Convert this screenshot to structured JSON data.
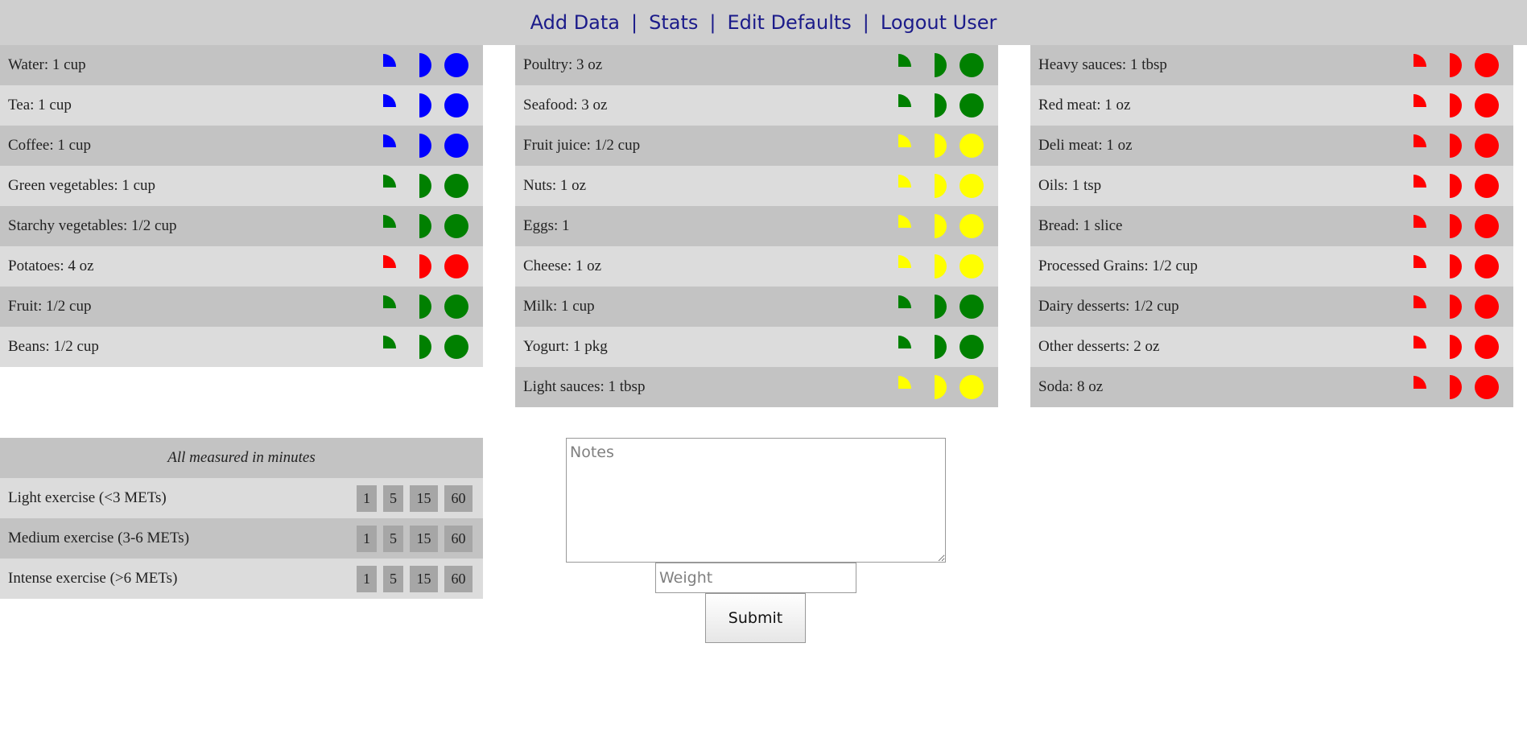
{
  "nav": {
    "add_data": "Add Data",
    "stats": "Stats",
    "edit_defaults": "Edit Defaults",
    "logout": "Logout User",
    "separator": "|"
  },
  "colors": {
    "blue": "#0000ff",
    "green": "#008000",
    "yellow": "#ffff00",
    "red": "#ff0000"
  },
  "food_columns": [
    {
      "items": [
        {
          "label": "Water: 1 cup",
          "color": "blue"
        },
        {
          "label": "Tea: 1 cup",
          "color": "blue"
        },
        {
          "label": "Coffee: 1 cup",
          "color": "blue"
        },
        {
          "label": "Green vegetables: 1 cup",
          "color": "green"
        },
        {
          "label": "Starchy vegetables: 1/2 cup",
          "color": "green"
        },
        {
          "label": "Potatoes: 4 oz",
          "color": "red"
        },
        {
          "label": "Fruit: 1/2 cup",
          "color": "green"
        },
        {
          "label": "Beans: 1/2 cup",
          "color": "green"
        }
      ]
    },
    {
      "items": [
        {
          "label": "Poultry: 3 oz",
          "color": "green"
        },
        {
          "label": "Seafood: 3 oz",
          "color": "green"
        },
        {
          "label": "Fruit juice: 1/2 cup",
          "color": "yellow"
        },
        {
          "label": "Nuts: 1 oz",
          "color": "yellow"
        },
        {
          "label": "Eggs: 1",
          "color": "yellow"
        },
        {
          "label": "Cheese: 1 oz",
          "color": "yellow"
        },
        {
          "label": "Milk: 1 cup",
          "color": "green"
        },
        {
          "label": "Yogurt: 1 pkg",
          "color": "green"
        },
        {
          "label": "Light sauces: 1 tbsp",
          "color": "yellow"
        }
      ]
    },
    {
      "items": [
        {
          "label": "Heavy sauces: 1 tbsp",
          "color": "red"
        },
        {
          "label": "Red meat: 1 oz",
          "color": "red"
        },
        {
          "label": "Deli meat: 1 oz",
          "color": "red"
        },
        {
          "label": "Oils: 1 tsp",
          "color": "red"
        },
        {
          "label": "Bread: 1 slice",
          "color": "red"
        },
        {
          "label": "Processed Grains: 1/2 cup",
          "color": "red"
        },
        {
          "label": "Dairy desserts: 1/2 cup",
          "color": "red"
        },
        {
          "label": "Other desserts: 2 oz",
          "color": "red"
        },
        {
          "label": "Soda: 8 oz",
          "color": "red"
        }
      ]
    }
  ],
  "exercise": {
    "header": "All measured in minutes",
    "durations": [
      "1",
      "5",
      "15",
      "60"
    ],
    "rows": [
      {
        "label": "Light exercise (<3 METs)"
      },
      {
        "label": "Medium exercise (3-6 METs)"
      },
      {
        "label": "Intense exercise (>6 METs)"
      }
    ]
  },
  "form": {
    "notes_placeholder": "Notes",
    "weight_placeholder": "Weight",
    "submit_label": "Submit"
  }
}
